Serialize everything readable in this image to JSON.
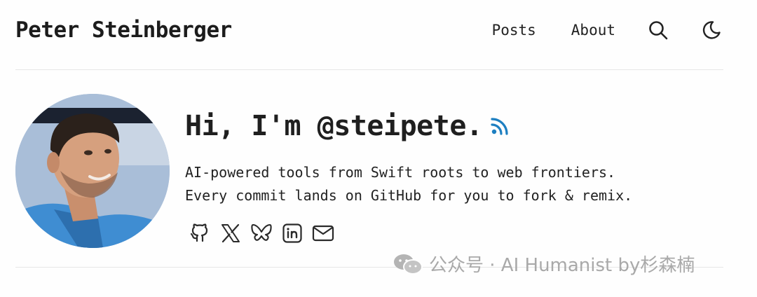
{
  "header": {
    "site_title": "Peter Steinberger",
    "nav": [
      {
        "label": "Posts"
      },
      {
        "label": "About"
      }
    ],
    "icons": [
      "search-icon",
      "moon-icon"
    ]
  },
  "profile": {
    "greeting": "Hi, I'm @steipete.",
    "bio_lines": [
      "AI-powered tools from Swift roots to web frontiers.",
      "Every commit lands on GitHub for you to fork & remix."
    ],
    "socials": [
      "github-icon",
      "x-icon",
      "bluesky-icon",
      "linkedin-icon",
      "mail-icon"
    ],
    "rss_color": "#1d7fc1"
  },
  "watermark": {
    "text": "公众号 · AI Humanist by杉森楠"
  }
}
